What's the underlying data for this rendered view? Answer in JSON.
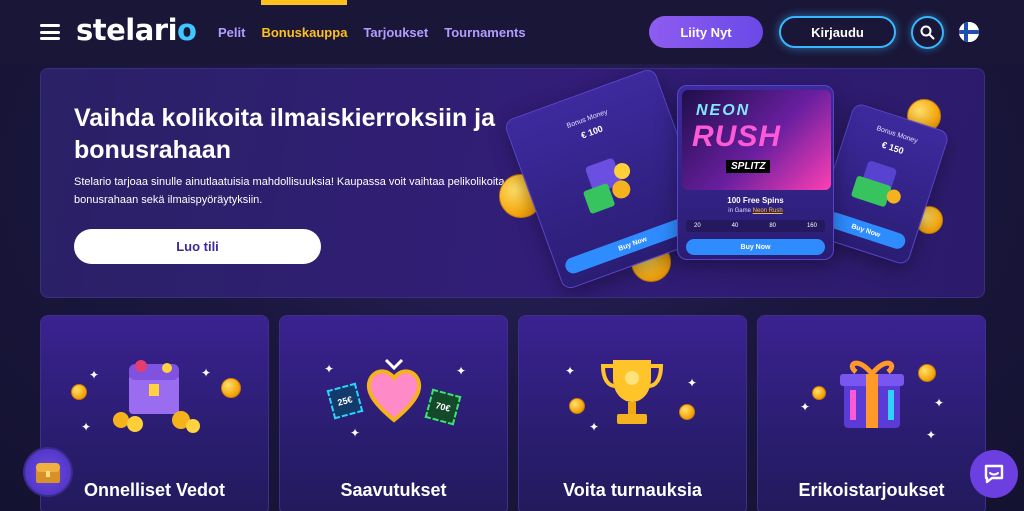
{
  "header": {
    "logo": {
      "pre": "stelari",
      "o": "o"
    },
    "nav": [
      {
        "label": "Pelit",
        "active": false
      },
      {
        "label": "Bonuskauppa",
        "active": true
      },
      {
        "label": "Tarjoukset",
        "active": false
      },
      {
        "label": "Tournaments",
        "active": false
      }
    ],
    "join_label": "Liity Nyt",
    "login_label": "Kirjaudu",
    "icons": [
      "menu-icon",
      "search-icon",
      "finland-flag-icon"
    ]
  },
  "hero": {
    "title": "Vaihda kolikoita ilmaiskierroksiin ja bonusrahaan",
    "description": "Stelario tarjoaa sinulle ainutlaatuisia mahdollisuuksia! Kaupassa voit vaihtaa pelikolikoita bonusrahaan sekä ilmaispyöräytyksiin.",
    "cta_label": "Luo tili",
    "cards": {
      "left": {
        "title": "Bonus Money",
        "value": "€ 100",
        "buy": "Buy Now"
      },
      "center": {
        "game_logo_line1": "NEON",
        "game_logo_line2": "RUSH",
        "game_logo_sub": "SPLITZ",
        "spins_title": "100 Free Spins",
        "in_game_prefix": "in Game",
        "in_game_name": "Neon Rush",
        "stakes": [
          "20",
          "40",
          "80",
          "160"
        ],
        "buy": "Buy Now"
      },
      "right": {
        "title": "Bonus Money",
        "value": "€ 150",
        "buy": "Buy Now"
      }
    }
  },
  "features": [
    {
      "title": "Onnelliset Vedot",
      "icon": "treasure-chest-icon"
    },
    {
      "title": "Saavutukset",
      "icon": "heart-jewel-icon",
      "badges": [
        "25€",
        "70€"
      ]
    },
    {
      "title": "Voita turnauksia",
      "icon": "trophy-icon"
    },
    {
      "title": "Erikoistarjoukset",
      "icon": "gift-box-icon"
    }
  ],
  "colors": {
    "accent_yellow": "#ffc01e",
    "nav_purple": "#b39cff",
    "cyan": "#38b7ff",
    "hero_bg": "#2f1f70"
  }
}
